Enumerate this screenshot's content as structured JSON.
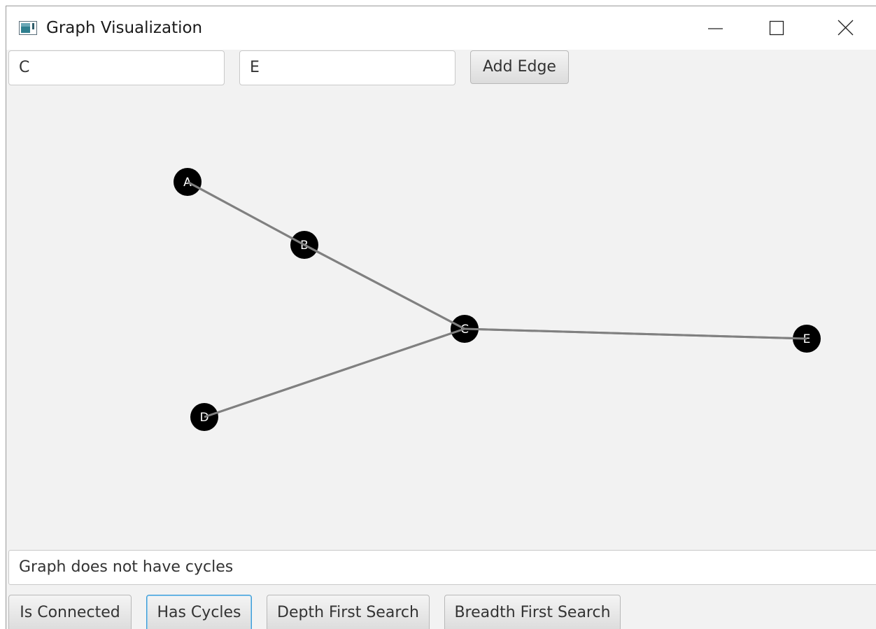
{
  "window": {
    "title": "Graph Visualization",
    "icons": {
      "app": "app-icon",
      "minimize": "minimize-icon",
      "maximize": "maximize-icon",
      "close": "close-icon"
    }
  },
  "edge_form": {
    "from_value": "C",
    "to_value": "E",
    "add_button_label": "Add Edge"
  },
  "graph": {
    "nodes": [
      {
        "id": "A",
        "label": "A"
      },
      {
        "id": "B",
        "label": "B"
      },
      {
        "id": "C",
        "label": "C"
      },
      {
        "id": "D",
        "label": "D"
      },
      {
        "id": "E",
        "label": "E"
      }
    ],
    "edges": [
      {
        "from": "A",
        "to": "B"
      },
      {
        "from": "B",
        "to": "C"
      },
      {
        "from": "D",
        "to": "C"
      },
      {
        "from": "C",
        "to": "E"
      }
    ],
    "node_color": "#000000",
    "edge_color": "#808080",
    "label_color": "#ffffff"
  },
  "status": {
    "message": "Graph does not have cycles"
  },
  "actions": {
    "is_connected": "Is Connected",
    "has_cycles": "Has Cycles",
    "depth_first_search": "Depth First Search",
    "breadth_first_search": "Breadth First Search"
  },
  "colors": {
    "focus_accent": "#3d9bd5",
    "background": "#f2f2f2"
  }
}
